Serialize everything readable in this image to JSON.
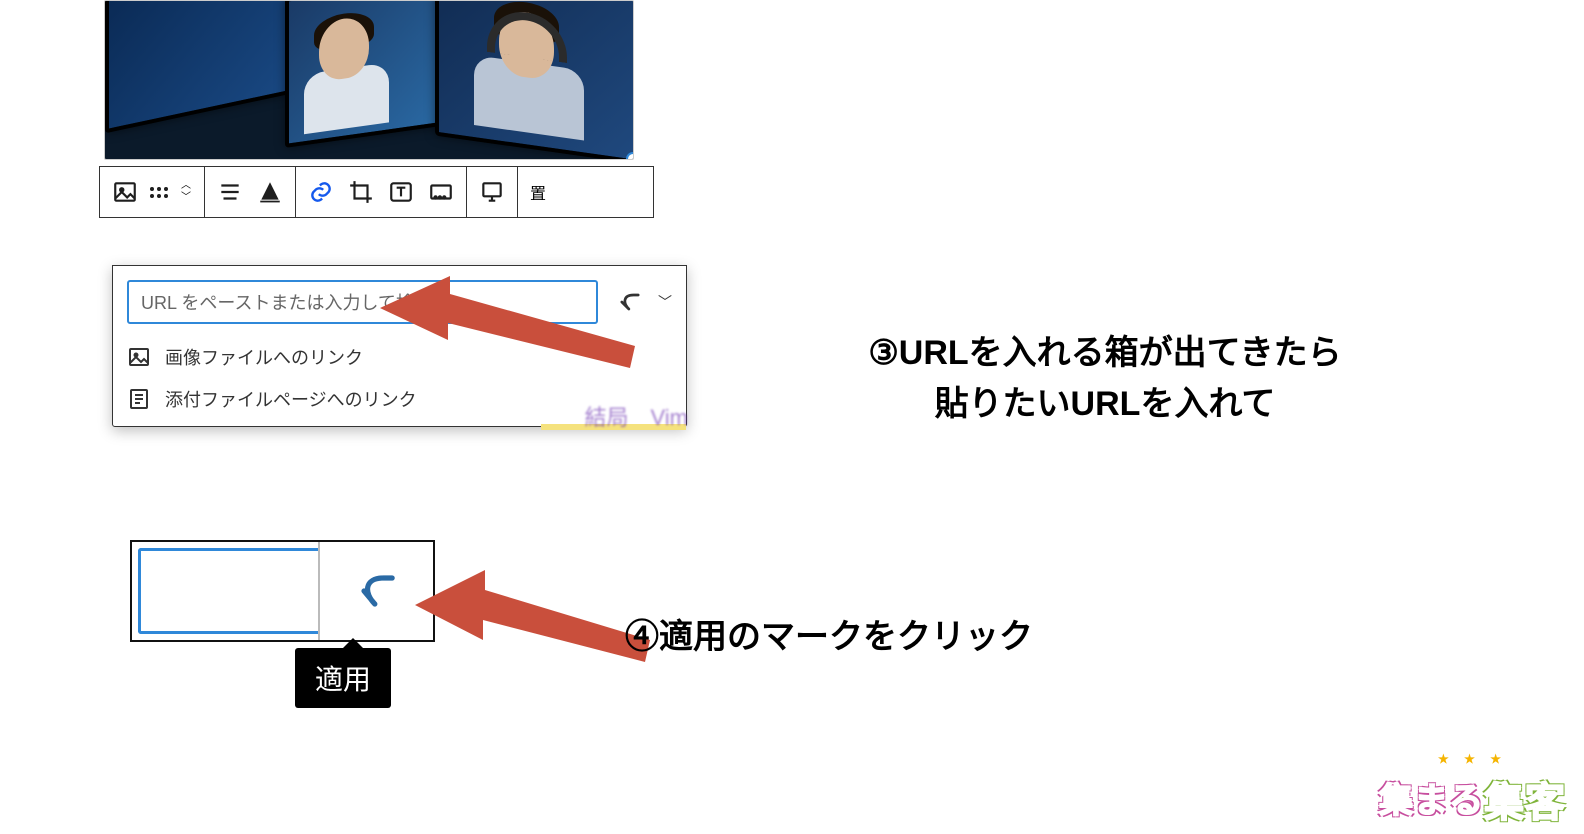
{
  "editor": {
    "toolbar": {
      "replace_label": "置"
    }
  },
  "link_dialog": {
    "url_placeholder": "URL をペーストまたは入力して検索",
    "options": {
      "image_file": "画像ファイルへのリンク",
      "attachment_page": "添付ファイルページへのリンク"
    },
    "hidden_text": "結局　Vim"
  },
  "apply_tooltip": "適用",
  "annotations": {
    "step3_line1": "③URLを入れる箱が出てきたら",
    "step3_line2": "貼りたいURLを入れて",
    "step4": "④適用のマークをクリック"
  },
  "brand": {
    "part1": "集まる",
    "part2": "集客"
  }
}
